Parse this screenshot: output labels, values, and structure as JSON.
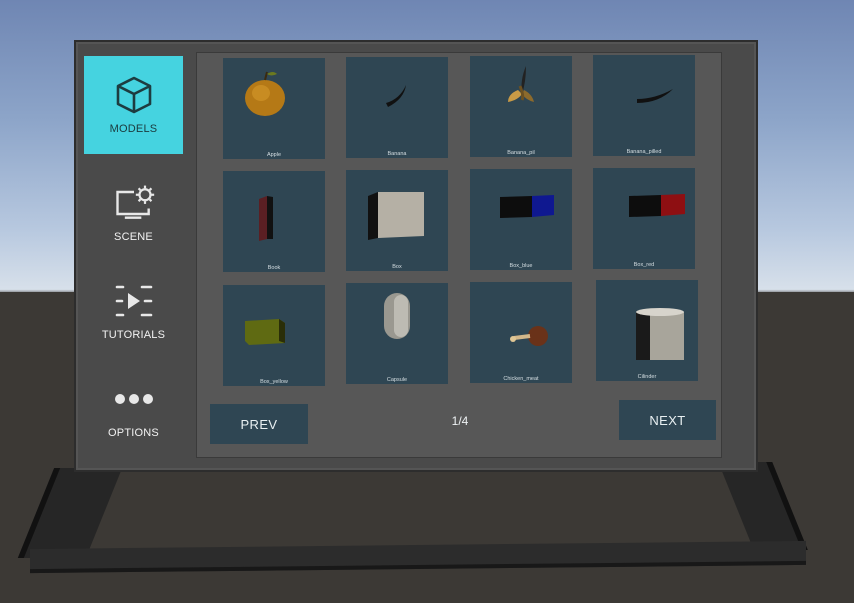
{
  "sidebar": {
    "items": [
      {
        "label": "MODELS",
        "icon": "cube-icon",
        "active": true
      },
      {
        "label": "SCENE",
        "icon": "screen-gear-icon",
        "active": false
      },
      {
        "label": "TUTORIALS",
        "icon": "tutorial-slides-icon",
        "active": false
      },
      {
        "label": "OPTIONS",
        "icon": "more-dots-icon",
        "active": false
      }
    ]
  },
  "grid": {
    "items": [
      {
        "label": "Apple"
      },
      {
        "label": "Banana"
      },
      {
        "label": "Banana_pil"
      },
      {
        "label": "Banana_pilled"
      },
      {
        "label": "Book"
      },
      {
        "label": "Box"
      },
      {
        "label": "Box_blue"
      },
      {
        "label": "Box_red"
      },
      {
        "label": "Box_yellow"
      },
      {
        "label": "Capsule"
      },
      {
        "label": "Chicken_meat"
      },
      {
        "label": "Cilinder"
      }
    ]
  },
  "pager": {
    "prev_label": "PREV",
    "next_label": "NEXT",
    "page_text": "1/4"
  },
  "colors": {
    "active_tab": "#45d3e0",
    "tile_bg": "#2f4653",
    "panel_bg": "#4a4a4a"
  }
}
